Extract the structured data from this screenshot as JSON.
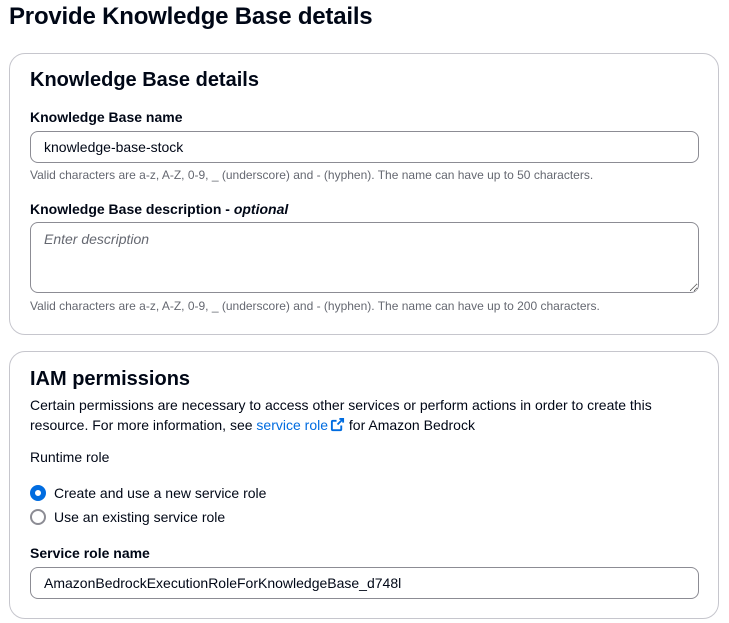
{
  "page": {
    "title": "Provide Knowledge Base details"
  },
  "kb_panel": {
    "title": "Knowledge Base details",
    "name_label": "Knowledge Base name",
    "name_value": "knowledge-base-stock",
    "name_hint": "Valid characters are a-z, A-Z, 0-9, _ (underscore) and - (hyphen). The name can have up to 50 characters.",
    "description_label": "Knowledge Base description - ",
    "description_optional": "optional",
    "description_placeholder": "Enter description",
    "description_hint": "Valid characters are a-z, A-Z, 0-9, _ (underscore) and - (hyphen). The name can have up to 200 characters."
  },
  "iam_panel": {
    "title": "IAM permissions",
    "description_before": "Certain permissions are necessary to access other services or perform actions in order to create this resource. For more information, see ",
    "description_link": "service role",
    "description_after": " for Amazon Bedrock",
    "runtime_role_label": "Runtime role",
    "radio_options": [
      {
        "label": "Create and use a new service role",
        "checked": true
      },
      {
        "label": "Use an existing service role",
        "checked": false
      }
    ],
    "service_role_label": "Service role name",
    "service_role_value": "AmazonBedrockExecutionRoleForKnowledgeBase_d748l"
  },
  "colors": {
    "link": "#006ce0",
    "border": "#8c8c94",
    "hint": "#656871"
  },
  "icons": {
    "external_link": "external-link-icon"
  }
}
